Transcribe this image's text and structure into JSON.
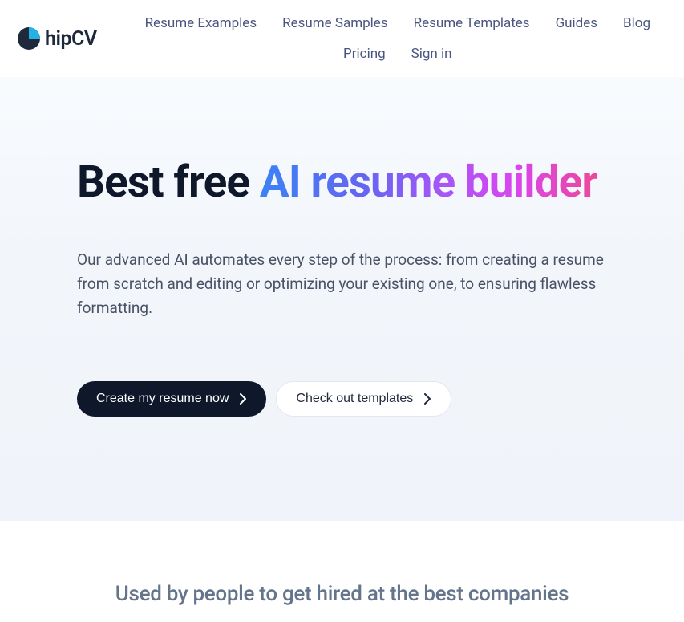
{
  "logo": {
    "text": "hipCV"
  },
  "nav": {
    "row1": [
      "Resume Examples",
      "Resume Samples",
      "Resume Templates",
      "Guides",
      "Blog"
    ],
    "row2": [
      "Pricing",
      "Sign in"
    ]
  },
  "hero": {
    "title_plain": "Best free ",
    "title_gradient": "AI resume builder",
    "subtitle": "Our advanced AI automates every step of the process: from creating a resume from scratch and editing or optimizing your existing one, to ensuring flawless formatting.",
    "btn_primary": "Create my resume now",
    "btn_secondary": "Check out templates"
  },
  "section2": {
    "title": "Used by people to get hired at the best companies"
  }
}
